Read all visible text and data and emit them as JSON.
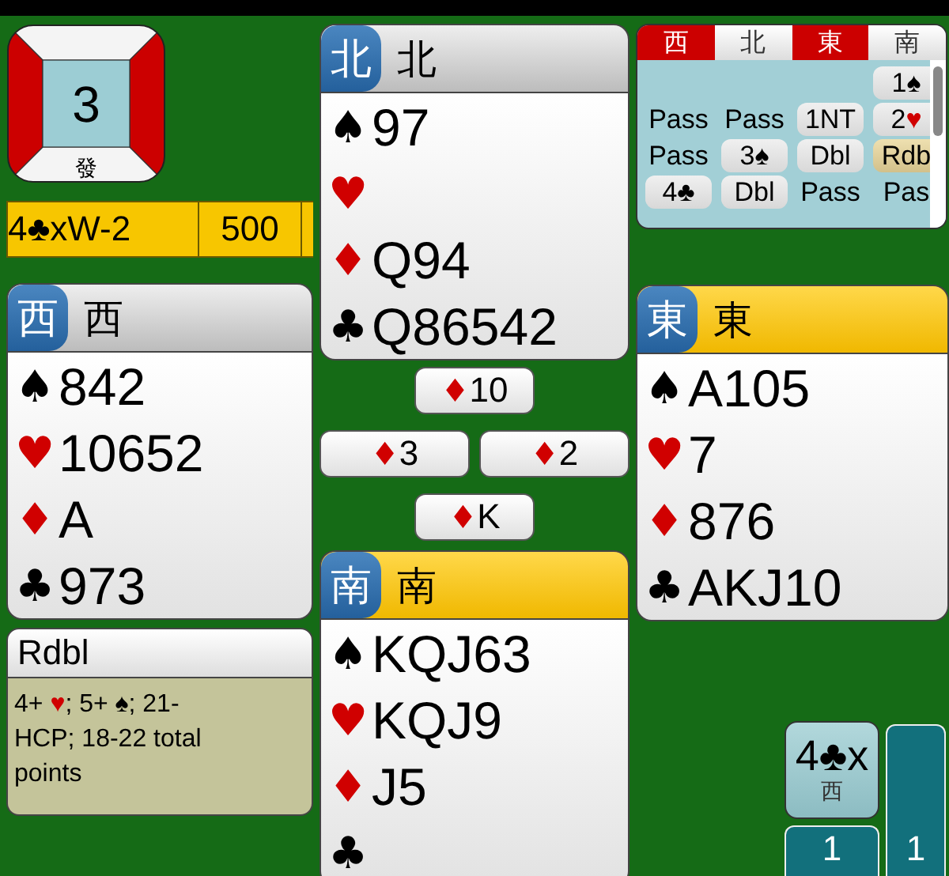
{
  "board": {
    "number": "3",
    "dealer_label": "發",
    "ns_vulnerable": false,
    "ew_vulnerable": true
  },
  "score": [
    "4♣xW-2",
    "500"
  ],
  "hands": [
    {
      "badge": "北",
      "name": "北",
      "highlighted": false,
      "suits": [
        {
          "symbol": "♠",
          "red": false,
          "cards": "97"
        },
        {
          "symbol": "♥",
          "red": true
        },
        {
          "symbol": "♦",
          "red": true,
          "cards": "Q94"
        },
        {
          "symbol": "♣",
          "red": false,
          "cards": "Q86542"
        }
      ]
    },
    {
      "badge": "西",
      "name": "西",
      "highlighted": false,
      "suits": [
        {
          "symbol": "♠",
          "red": false,
          "cards": "842"
        },
        {
          "symbol": "♥",
          "red": true,
          "cards": "10652"
        },
        {
          "symbol": "♦",
          "red": true,
          "cards": "A"
        },
        {
          "symbol": "♣",
          "red": false,
          "cards": "973"
        }
      ]
    },
    {
      "badge": "東",
      "name": "東",
      "highlighted": true,
      "suits": [
        {
          "symbol": "♠",
          "red": false,
          "cards": "A105"
        },
        {
          "symbol": "♥",
          "red": true,
          "cards": "7"
        },
        {
          "symbol": "♦",
          "red": true,
          "cards": "876"
        },
        {
          "symbol": "♣",
          "red": false,
          "cards": "AKJ10"
        }
      ]
    },
    {
      "badge": "南",
      "name": "南",
      "highlighted": true,
      "suits": [
        {
          "symbol": "♠",
          "red": false,
          "cards": "KQJ63"
        },
        {
          "symbol": "♥",
          "red": true,
          "cards": "KQJ9"
        },
        {
          "symbol": "♦",
          "red": true,
          "cards": "J5"
        },
        {
          "symbol": "♣",
          "red": false
        }
      ]
    }
  ],
  "tricks": [
    {
      "symbol": "♦",
      "red": true,
      "rank": "10"
    },
    {
      "symbol": "♦",
      "red": true,
      "rank": "3"
    },
    {
      "symbol": "♦",
      "red": true,
      "rank": "2"
    },
    {
      "symbol": "♦",
      "red": true,
      "rank": "K"
    }
  ],
  "auction": {
    "headers": [
      {
        "label": "西",
        "vulnerable": true
      },
      {
        "label": "北",
        "vulnerable": false
      },
      {
        "label": "東",
        "vulnerable": true
      },
      {
        "label": "南",
        "vulnerable": false
      }
    ],
    "calls": [
      {
        "kind": "empty"
      },
      {
        "kind": "empty"
      },
      {
        "kind": "empty"
      },
      {
        "kind": "call",
        "text": "1",
        "symbol": "♠",
        "red": false,
        "selected": false
      },
      {
        "kind": "pass",
        "text": "Pass",
        "selected": false
      },
      {
        "kind": "pass",
        "text": "Pass",
        "selected": false
      },
      {
        "kind": "call",
        "text": "1NT",
        "selected": false
      },
      {
        "kind": "call",
        "text": "2",
        "symbol": "♥",
        "red": true,
        "selected": false
      },
      {
        "kind": "pass",
        "text": "Pass",
        "selected": false
      },
      {
        "kind": "call",
        "text": "3",
        "symbol": "♠",
        "red": false,
        "selected": false
      },
      {
        "kind": "call",
        "text": "Dbl",
        "selected": false
      },
      {
        "kind": "call",
        "text": "Rdb",
        "selected": true
      },
      {
        "kind": "call",
        "text": "4",
        "symbol": "♣",
        "red": false,
        "selected": false
      },
      {
        "kind": "call",
        "text": "Dbl",
        "selected": false
      },
      {
        "kind": "pass",
        "text": "Pass",
        "selected": false
      },
      {
        "kind": "pass",
        "text": "Pas",
        "selected": false
      }
    ]
  },
  "explanation": {
    "title": "Rdbl",
    "parts": [
      {
        "text": "4+ "
      },
      {
        "text": "♥",
        "red": true
      },
      {
        "text": "; 5+ "
      },
      {
        "text": "♠",
        "red": false
      },
      {
        "text": "; 21-HCP; 18-22 total points"
      }
    ]
  },
  "contract": {
    "text": "4",
    "symbol": "♣",
    "red": false,
    "suffix": "x",
    "declarer": "西"
  },
  "trick_counters": [
    {
      "count": "1"
    },
    {
      "count": "1"
    }
  ]
}
